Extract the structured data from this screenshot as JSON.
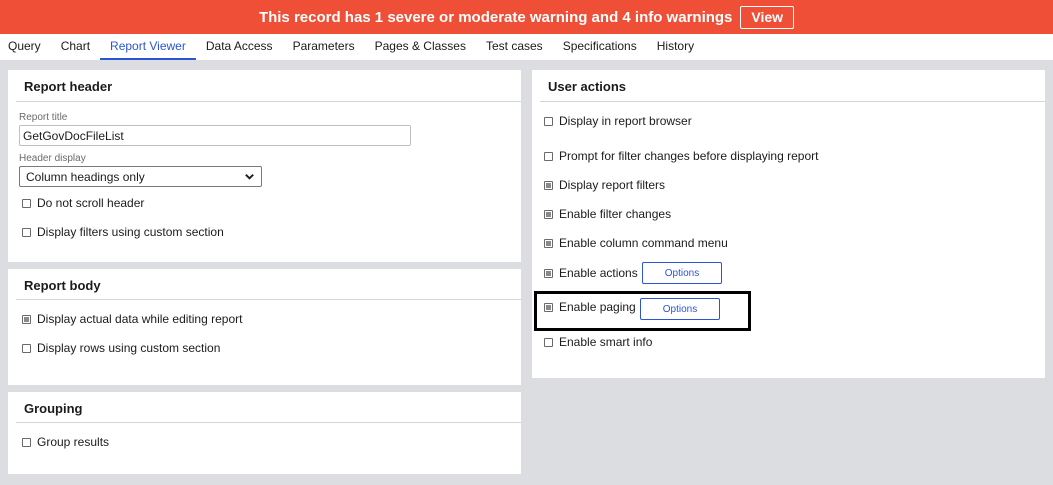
{
  "banner": {
    "message": "This record has 1 severe or moderate warning and 4 info warnings",
    "view_label": "View",
    "color": "#ef4f36"
  },
  "tabs": [
    {
      "label": "Query",
      "active": false
    },
    {
      "label": "Chart",
      "active": false
    },
    {
      "label": "Report Viewer",
      "active": true
    },
    {
      "label": "Data Access",
      "active": false
    },
    {
      "label": "Parameters",
      "active": false
    },
    {
      "label": "Pages & Classes",
      "active": false
    },
    {
      "label": "Test cases",
      "active": false
    },
    {
      "label": "Specifications",
      "active": false
    },
    {
      "label": "History",
      "active": false
    }
  ],
  "report_header": {
    "title": "Report header",
    "report_title_label": "Report title",
    "report_title_value": "GetGovDocFileList",
    "header_display_label": "Header display",
    "header_display_value": "Column headings only",
    "checkboxes": [
      {
        "label": "Do not scroll header",
        "checked": false
      },
      {
        "label": "Display filters using custom section",
        "checked": false
      }
    ]
  },
  "report_body": {
    "title": "Report body",
    "checkboxes": [
      {
        "label": "Display actual data while editing report",
        "checked": true
      },
      {
        "label": "Display rows using custom section",
        "checked": false
      }
    ]
  },
  "grouping": {
    "title": "Grouping",
    "checkboxes": [
      {
        "label": "Group results",
        "checked": false
      }
    ]
  },
  "user_actions": {
    "title": "User actions",
    "checkboxes": [
      {
        "label": "Display in report browser",
        "checked": false
      },
      {
        "label": "Prompt for filter changes before displaying report",
        "checked": false
      },
      {
        "label": "Display report filters",
        "checked": true
      },
      {
        "label": "Enable filter changes",
        "checked": true
      },
      {
        "label": "Enable column command menu",
        "checked": true
      },
      {
        "label": "Enable actions",
        "checked": true
      },
      {
        "label": "Enable paging",
        "checked": true
      },
      {
        "label": "Enable smart info",
        "checked": false
      }
    ],
    "actions_options_label": "Options",
    "paging_options_label": "Options"
  },
  "accent_color": "#2b55d3"
}
